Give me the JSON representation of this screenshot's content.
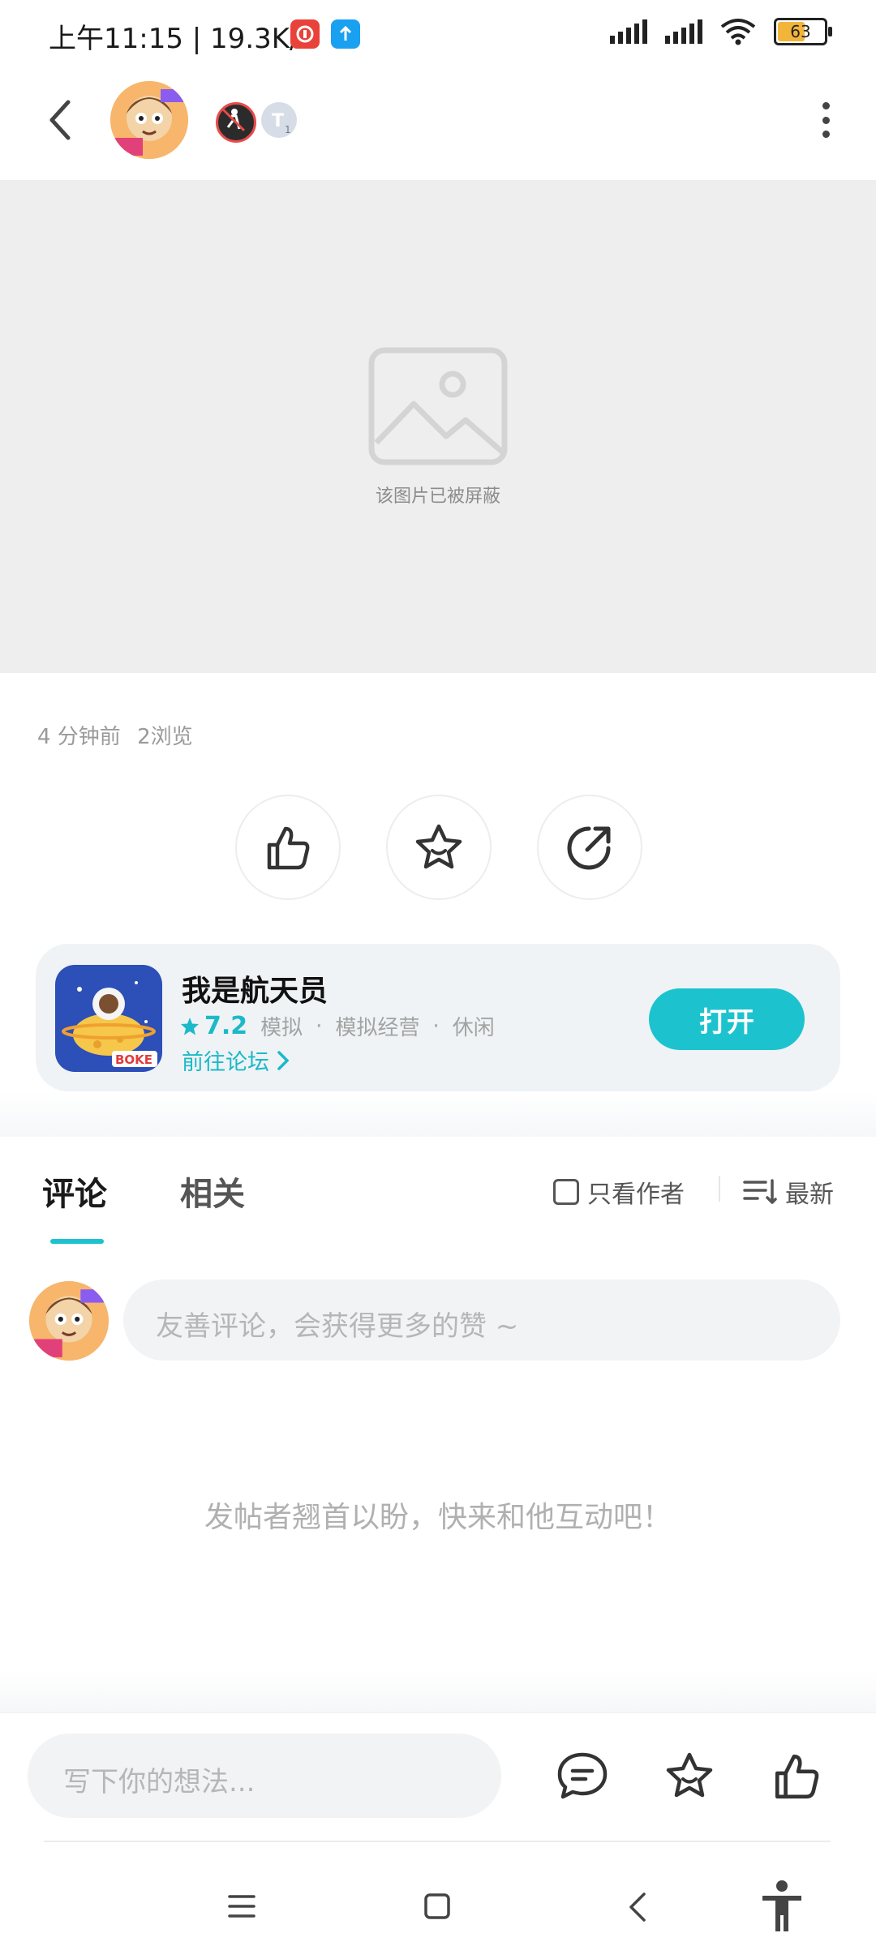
{
  "status_bar": {
    "time_and_speed": "上午11:15 | 19.3K/s",
    "battery_level": "63",
    "battery_fraction": 0.63
  },
  "post": {
    "blocked_image_text": "该图片已被屏蔽",
    "time_ago": "4 分钟前",
    "views": "2浏览"
  },
  "game_card": {
    "name": "我是航天员",
    "rating": "7.2",
    "tags": [
      "模拟",
      "模拟经营",
      "休闲"
    ],
    "separator": "·",
    "forum_link": "前往论坛",
    "open_button": "打开",
    "icon_label": "BOKE"
  },
  "comments": {
    "tabs": [
      "评论",
      "相关"
    ],
    "only_author": "只看作者",
    "sort": "最新",
    "input_placeholder": "友善评论，会获得更多的赞 ~",
    "empty_text": "发帖者翘首以盼，快来和他互动吧！"
  },
  "bottom_bar": {
    "placeholder": "写下你的想法..."
  },
  "colors": {
    "accent": "#1cc3cf",
    "blocked_bg": "#eeeeee",
    "card_bg": "#eff3f6"
  }
}
